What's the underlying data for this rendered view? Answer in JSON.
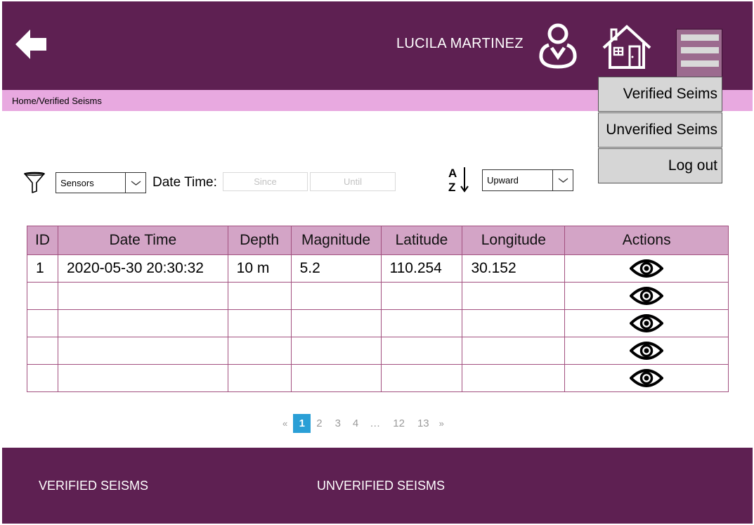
{
  "header": {
    "username": "LUCILA MARTINEZ",
    "bg_color": "#5e2052",
    "icons": [
      "back-arrow-icon",
      "user-icon",
      "home-icon",
      "hamburger-menu-icon"
    ]
  },
  "breadcrumb": "Home/Verified Seisms",
  "menu": {
    "items": [
      {
        "label": "Verified Seims"
      },
      {
        "label": "Unverified Seims"
      },
      {
        "label": "Log out"
      }
    ]
  },
  "filters": {
    "sensor_select": "Sensors",
    "datetime_label": "Date Time:",
    "since_placeholder": "Since",
    "until_placeholder": "Until",
    "sort_select": "Upward"
  },
  "table": {
    "columns": [
      "ID",
      "Date Time",
      "Depth",
      "Magnitude",
      "Latitude",
      "Longitude",
      "Actions"
    ],
    "rows": [
      [
        "1",
        "2020-05-30 20:30:32",
        "10 m",
        "5.2",
        "110.254",
        "30.152"
      ],
      [
        "",
        "",
        "",
        "",
        "",
        ""
      ],
      [
        "",
        "",
        "",
        "",
        "",
        ""
      ],
      [
        "",
        "",
        "",
        "",
        "",
        ""
      ],
      [
        "",
        "",
        "",
        "",
        "",
        ""
      ]
    ]
  },
  "pagination": {
    "prev": "«",
    "pages": [
      "1",
      "2",
      "3",
      "4",
      "…",
      "12",
      "13"
    ],
    "next": "»",
    "current": "1"
  },
  "footer": {
    "links": [
      "VERIFIED SEISMS",
      "UNVERIFIED SEISMS"
    ]
  },
  "colors": {
    "accent": "#5e2052",
    "breadcrumb_bg": "#e8a9e0",
    "table_header_bg": "#d3a4c6",
    "pagination_active": "#2a9fd6"
  }
}
